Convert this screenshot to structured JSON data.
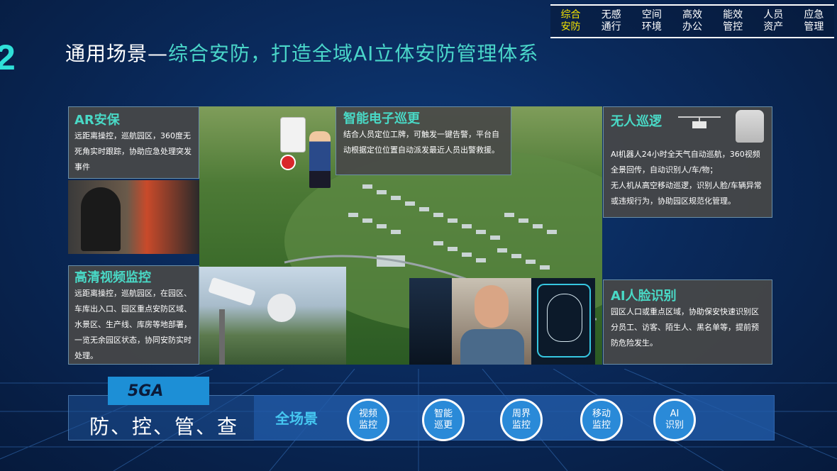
{
  "slide_number": "2",
  "nav": [
    {
      "line1": "综合",
      "line2": "安防",
      "active": true
    },
    {
      "line1": "无感",
      "line2": "通行",
      "active": false
    },
    {
      "line1": "空间",
      "line2": "环境",
      "active": false
    },
    {
      "line1": "高效",
      "line2": "办公",
      "active": false
    },
    {
      "line1": "能效",
      "line2": "管控",
      "active": false
    },
    {
      "line1": "人员",
      "line2": "资产",
      "active": false
    },
    {
      "line1": "应急",
      "line2": "管理",
      "active": false
    }
  ],
  "title": {
    "prefix": "通用场景—",
    "highlight": "综合安防，打造全域AI立体安防管理体系"
  },
  "panels": {
    "ar": {
      "title": "AR安保",
      "text": "远距离操控，巡航园区，360度无死角实时跟踪，协助应急处理突发事件"
    },
    "patrol": {
      "title": "智能电子巡更",
      "text": "结合人员定位工牌，可触发一键告警，平台自动根据定位位置自动派发最近人员出警救援。"
    },
    "unmanned": {
      "title": "无人巡逻",
      "text1": "AI机器人24小时全天气自动巡航，360视频全景回传，自动识别人/车/物；",
      "text2": "无人机从高空移动巡逻，识别人脸/车辆异常或违规行为，协助园区规范化管理。"
    },
    "hd": {
      "title": "高清视频监控",
      "text": "远距离操控，巡航园区，在园区、车库出入口、园区重点安防区域、水景区、生产线、库房等地部署，一览无余园区状态，协同安防实时处理。"
    },
    "face": {
      "title": "AI人脸识别",
      "text": "园区人口或重点区域，协助保安快速识别区分员工、访客、陌生人、黑名单等，提前预防危险发生。"
    }
  },
  "bottom": {
    "tag": "5GA",
    "slogan": "防、控、管、查",
    "all_scene": "全场景",
    "circles": [
      {
        "l1": "视频",
        "l2": "监控"
      },
      {
        "l1": "智能",
        "l2": "巡更"
      },
      {
        "l1": "周界",
        "l2": "监控"
      },
      {
        "l1": "移动",
        "l2": "监控"
      },
      {
        "l1": "AI",
        "l2": "识别"
      }
    ]
  },
  "colors": {
    "accent": "#4ad6c9",
    "nav_active": "#f6e500",
    "panel_bg": "#484848",
    "circle": "#2a8ad8"
  }
}
